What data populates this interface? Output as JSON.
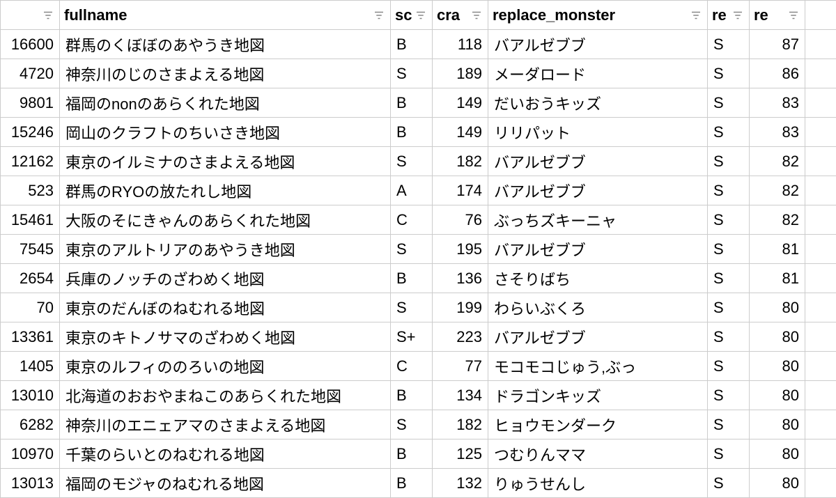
{
  "headers": {
    "id": "",
    "fullname": "fullname",
    "sc": "sc",
    "cra": "cra",
    "replace_monster": "replace_monster",
    "re1": "re",
    "re2": "re"
  },
  "rows": [
    {
      "id": "16600",
      "fullname": "群馬のくぼぼのあやうき地図",
      "sc": "B",
      "cra": "118",
      "replace_monster": "バアルゼブブ",
      "re1": "S",
      "re2": "87"
    },
    {
      "id": "4720",
      "fullname": "神奈川のじのさまよえる地図",
      "sc": "S",
      "cra": "189",
      "replace_monster": "メーダロード",
      "re1": "S",
      "re2": "86"
    },
    {
      "id": "9801",
      "fullname": "福岡のnonのあらくれた地図",
      "sc": "B",
      "cra": "149",
      "replace_monster": "だいおうキッズ",
      "re1": "S",
      "re2": "83"
    },
    {
      "id": "15246",
      "fullname": "岡山のクラフトのちいさき地図",
      "sc": "B",
      "cra": "149",
      "replace_monster": "リリパット",
      "re1": "S",
      "re2": "83"
    },
    {
      "id": "12162",
      "fullname": "東京のイルミナのさまよえる地図",
      "sc": "S",
      "cra": "182",
      "replace_monster": "バアルゼブブ",
      "re1": "S",
      "re2": "82"
    },
    {
      "id": "523",
      "fullname": "群馬のRYOの放たれし地図",
      "sc": "A",
      "cra": "174",
      "replace_monster": "バアルゼブブ",
      "re1": "S",
      "re2": "82"
    },
    {
      "id": "15461",
      "fullname": "大阪のそにきゃんのあらくれた地図",
      "sc": "C",
      "cra": "76",
      "replace_monster": "ぶっちズキーニャ",
      "re1": "S",
      "re2": "82"
    },
    {
      "id": "7545",
      "fullname": "東京のアルトリアのあやうき地図",
      "sc": "S",
      "cra": "195",
      "replace_monster": "バアルゼブブ",
      "re1": "S",
      "re2": "81"
    },
    {
      "id": "2654",
      "fullname": "兵庫のノッチのざわめく地図",
      "sc": "B",
      "cra": "136",
      "replace_monster": "さそりばち",
      "re1": "S",
      "re2": "81"
    },
    {
      "id": "70",
      "fullname": "東京のだんぼのねむれる地図",
      "sc": "S",
      "cra": "199",
      "replace_monster": "わらいぶくろ",
      "re1": "S",
      "re2": "80"
    },
    {
      "id": "13361",
      "fullname": "東京のキトノサマのざわめく地図",
      "sc": "S+",
      "cra": "223",
      "replace_monster": "バアルゼブブ",
      "re1": "S",
      "re2": "80"
    },
    {
      "id": "1405",
      "fullname": "東京のルフィののろいの地図",
      "sc": "C",
      "cra": "77",
      "replace_monster": "モコモコじゅう,ぶっ",
      "re1": "S",
      "re2": "80"
    },
    {
      "id": "13010",
      "fullname": "北海道のおおやまねこのあらくれた地図",
      "sc": "B",
      "cra": "134",
      "replace_monster": "ドラゴンキッズ",
      "re1": "S",
      "re2": "80"
    },
    {
      "id": "6282",
      "fullname": "神奈川のエニェアマのさまよえる地図",
      "sc": "S",
      "cra": "182",
      "replace_monster": "ヒョウモンダーク",
      "re1": "S",
      "re2": "80"
    },
    {
      "id": "10970",
      "fullname": "千葉のらいとのねむれる地図",
      "sc": "B",
      "cra": "125",
      "replace_monster": "つむりんママ",
      "re1": "S",
      "re2": "80"
    },
    {
      "id": "13013",
      "fullname": "福岡のモジャのねむれる地図",
      "sc": "B",
      "cra": "132",
      "replace_monster": "りゅうせんし",
      "re1": "S",
      "re2": "80"
    }
  ]
}
